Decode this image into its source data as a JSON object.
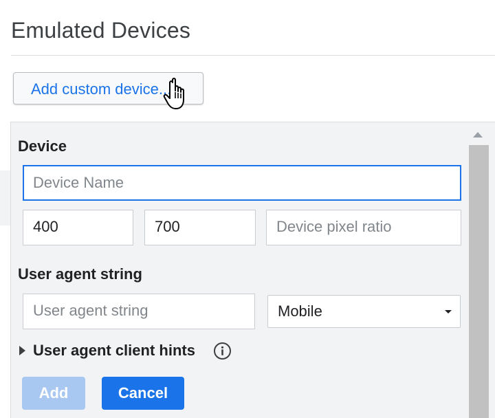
{
  "header": {
    "title": "Emulated Devices",
    "add_custom_label": "Add custom device..."
  },
  "form": {
    "device_section_label": "Device",
    "device_name_placeholder": "Device Name",
    "width_value": "400",
    "height_value": "700",
    "pixel_ratio_placeholder": "Device pixel ratio",
    "ua_section_label": "User agent string",
    "ua_placeholder": "User agent string",
    "ua_type_selected": "Mobile",
    "client_hints_label": "User agent client hints",
    "add_label": "Add",
    "cancel_label": "Cancel"
  },
  "colors": {
    "accent": "#1a73e8",
    "disabled_button": "#a8c7f1",
    "panel_background": "#f1f3f4"
  },
  "icons": [
    "hand-cursor-icon",
    "expand-triangle-icon",
    "info-icon",
    "chevron-down-icon",
    "scroll-up-icon"
  ]
}
